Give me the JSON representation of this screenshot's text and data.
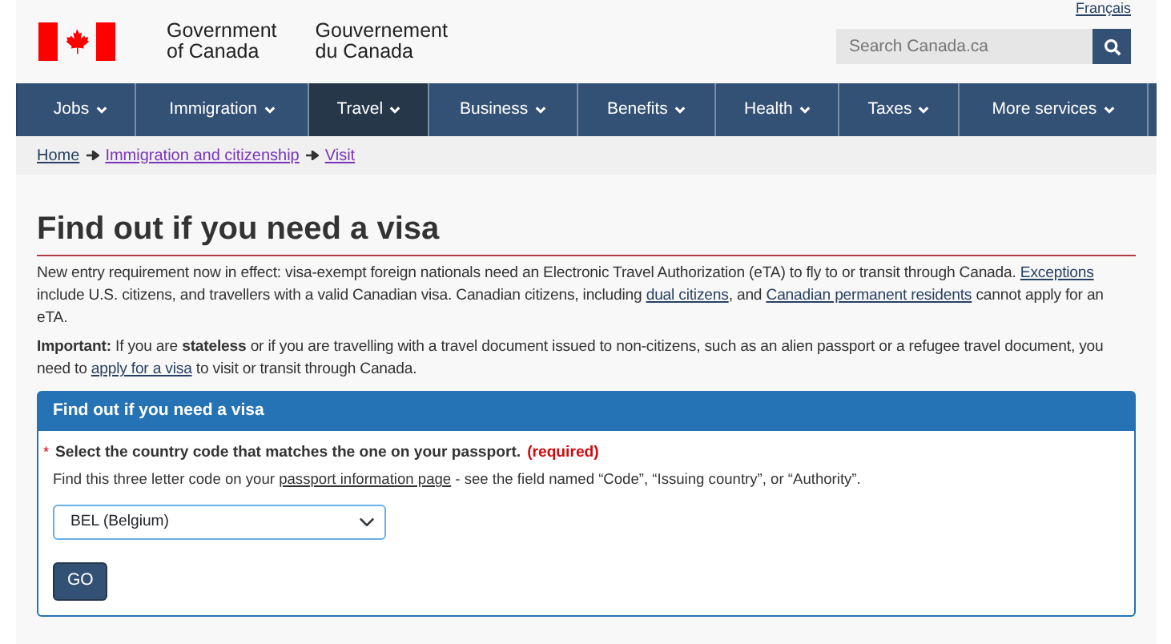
{
  "language_link": "Français",
  "signature": {
    "english": [
      "Government",
      "of Canada"
    ],
    "french": [
      "Gouvernement",
      "du Canada"
    ]
  },
  "search": {
    "placeholder": "Search Canada.ca"
  },
  "menu": [
    {
      "label": "Jobs",
      "selected": false
    },
    {
      "label": "Immigration",
      "selected": false
    },
    {
      "label": "Travel",
      "selected": true
    },
    {
      "label": "Business",
      "selected": false
    },
    {
      "label": "Benefits",
      "selected": false
    },
    {
      "label": "Health",
      "selected": false
    },
    {
      "label": "Taxes",
      "selected": false
    },
    {
      "label": "More services",
      "selected": false
    }
  ],
  "breadcrumb": [
    {
      "label": "Home",
      "visited": false
    },
    {
      "label": "Immigration and citizenship",
      "visited": true
    },
    {
      "label": "Visit",
      "visited": true
    }
  ],
  "title": "Find out if you need a visa",
  "paragraphs": [
    [
      {
        "kind": "text",
        "text": "New entry requirement now in effect: visa-exempt foreign nationals need an Electronic Travel Authorization (eTA) to fly to or transit through Canada. "
      },
      {
        "kind": "link",
        "text": "Exceptions"
      },
      {
        "kind": "text",
        "text": " include U.S. citizens, and travellers with a valid Canadian visa. Canadian citizens, including "
      },
      {
        "kind": "link",
        "text": "dual citizens"
      },
      {
        "kind": "text",
        "text": ", and "
      },
      {
        "kind": "link",
        "text": "Canadian permanent residents"
      },
      {
        "kind": "text",
        "text": " cannot apply for an eTA."
      }
    ],
    [
      {
        "kind": "text",
        "text": "**Important:** If you are **stateless** or if you are travelling with a travel document issued to non-citizens, such as an alien passport or a refugee travel document, you need to "
      },
      {
        "kind": "link",
        "text": "apply for a visa"
      },
      {
        "kind": "text",
        "text": " to visit or transit through Canada."
      }
    ]
  ],
  "panel": {
    "title": "Find out if you need a visa",
    "required_mark": "*",
    "label": "Select the country code that matches the one on your passport.",
    "required": "(required)",
    "help": [
      {
        "kind": "text",
        "text": "Find this three letter code on your "
      },
      {
        "kind": "link",
        "text": "passport information page"
      },
      {
        "kind": "text",
        "text": " - see the field named “Code”, “Issuing country”, or “Authority”."
      }
    ],
    "select_value": "BEL (Belgium)",
    "button": "GO"
  }
}
